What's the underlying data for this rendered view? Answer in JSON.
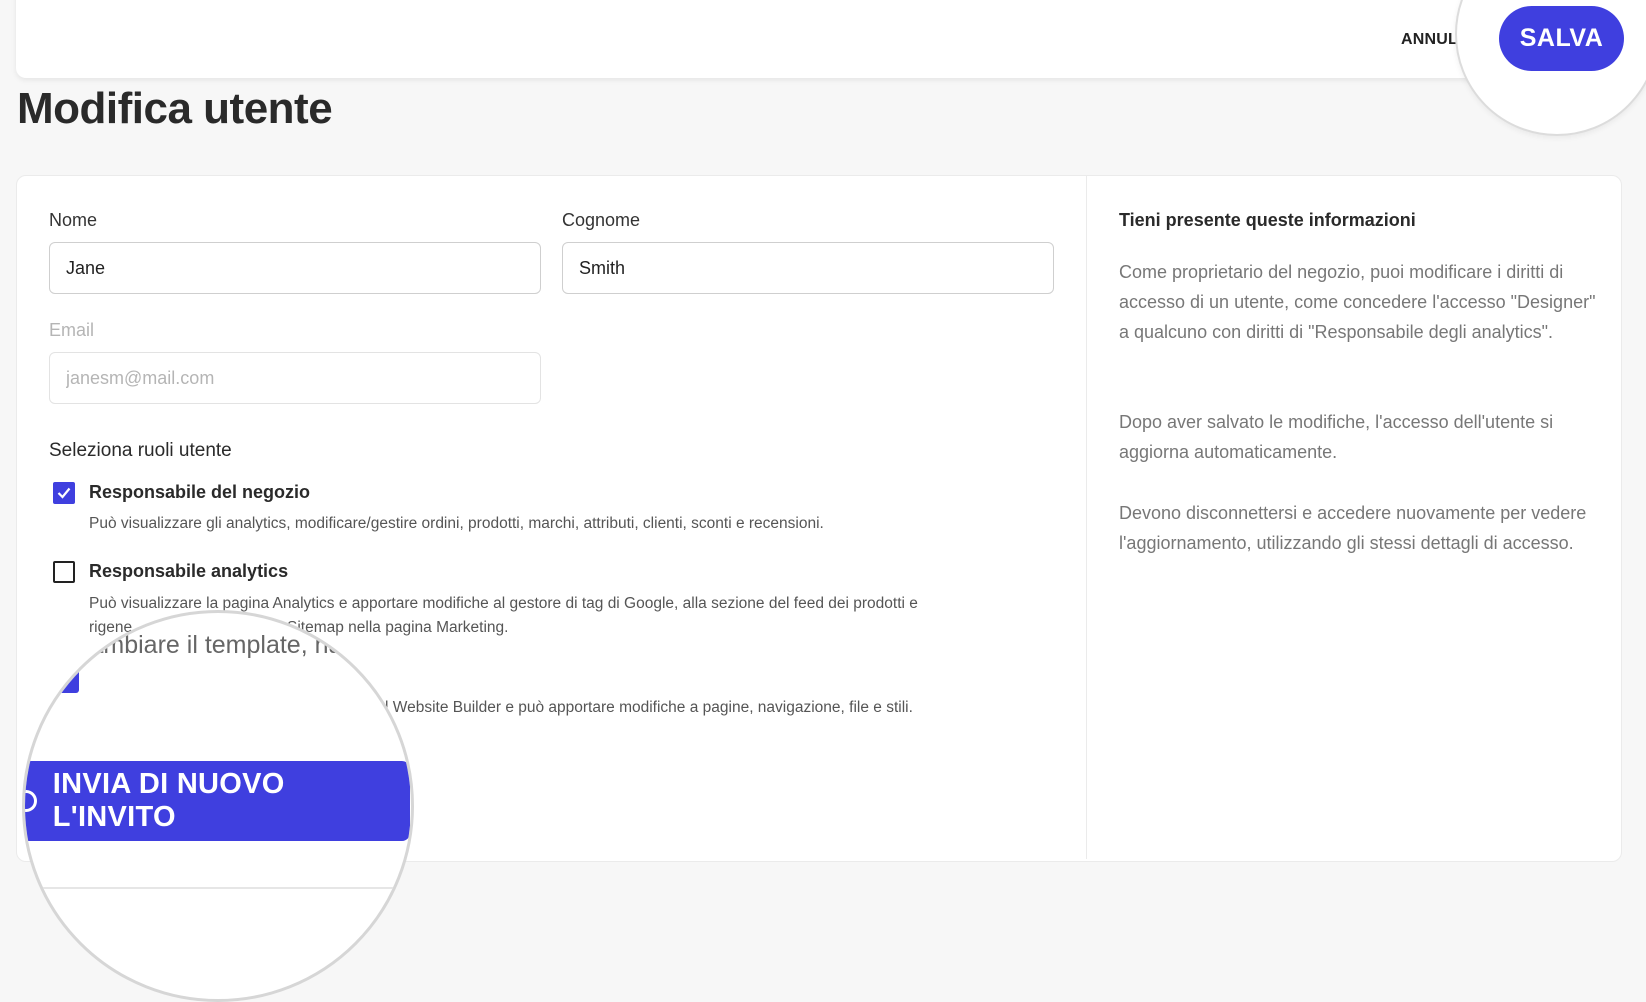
{
  "header": {
    "cancel_label": "ANNUL",
    "save_label": "SALVA"
  },
  "page": {
    "title": "Modifica utente"
  },
  "form": {
    "first_name": {
      "label": "Nome",
      "value": "Jane"
    },
    "last_name": {
      "label": "Cognome",
      "value": "Smith"
    },
    "email": {
      "label": "Email",
      "placeholder": "janesm@mail.com"
    },
    "roles_title": "Seleziona ruoli utente",
    "roles": [
      {
        "title": "Responsabile del negozio",
        "checked": true,
        "description": "Può visualizzare gli analytics, modificare/gestire ordini, prodotti, marchi, attributi, clienti, sconti e recensioni."
      },
      {
        "title": "Responsabile analytics",
        "checked": false,
        "description_line1": "Può visualizzare la pagina Analytics e apportare modifiche al gestore di tag di Google, alla sezione del feed dei prodotti e",
        "description_line2_visible": "rigene",
        "description_line2_end": "Sitemap nella pagina Marketing."
      },
      {
        "checked": true,
        "description_visible": "l Website Builder e può apportare modifiche a pagine, navigazione, file e stili."
      }
    ]
  },
  "magnifier": {
    "partial_text": "cambiare il template, ha",
    "resend_label": "INVIA DI NUOVO L'INVITO"
  },
  "info": {
    "title": "Tieni presente queste informazioni",
    "paragraph1": "Come proprietario del negozio, puoi modificare i diritti di accesso di un utente, come concedere l'accesso \"Designer\" a qualcuno con diritti di \"Responsabile degli analytics\".",
    "paragraph2": "Dopo aver salvato le modifiche, l'accesso dell'utente si aggiorna automaticamente.",
    "paragraph3": "Devono disconnettersi e accedere nuovamente per vedere l'aggiornamento, utilizzando gli stessi dettagli di accesso."
  },
  "colors": {
    "accent": "#3f3fdf",
    "background": "#f7f7f7",
    "card": "#ffffff"
  }
}
